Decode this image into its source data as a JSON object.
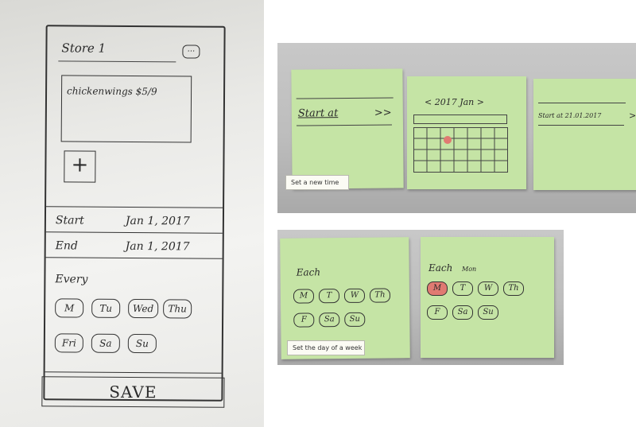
{
  "sketch": {
    "store_title": "Store 1",
    "more_label": "...",
    "menu_item": "chickenwings $5/9",
    "add_label": "+",
    "start_label": "Start",
    "start_value": "Jan 1, 2017",
    "end_label": "End",
    "end_value": "Jan 1, 2017",
    "every_label": "Every",
    "days_row1": [
      "M",
      "Tu",
      "Wed",
      "Thu"
    ],
    "days_row2": [
      "Fri",
      "Sa",
      "Su"
    ],
    "save_label": "SAVE"
  },
  "time_panel": {
    "caption": "Set a new time",
    "note1_label": "Start at",
    "note1_arrow": ">>",
    "note2_header": "< 2017 Jan >",
    "note3_label": "Start at  21.01.2017",
    "note3_arrow": ">"
  },
  "week_panel": {
    "caption": "Set the day of a week",
    "note1_title": "Each",
    "note2_title": "Each",
    "note2_suffix": "Mon",
    "days_row1": [
      "M",
      "T",
      "W",
      "Th"
    ],
    "days_row2": [
      "F",
      "Sa",
      "Su"
    ]
  },
  "colors": {
    "sticky_note": "#c5e4a5",
    "selected_marker": "#e07a72"
  }
}
